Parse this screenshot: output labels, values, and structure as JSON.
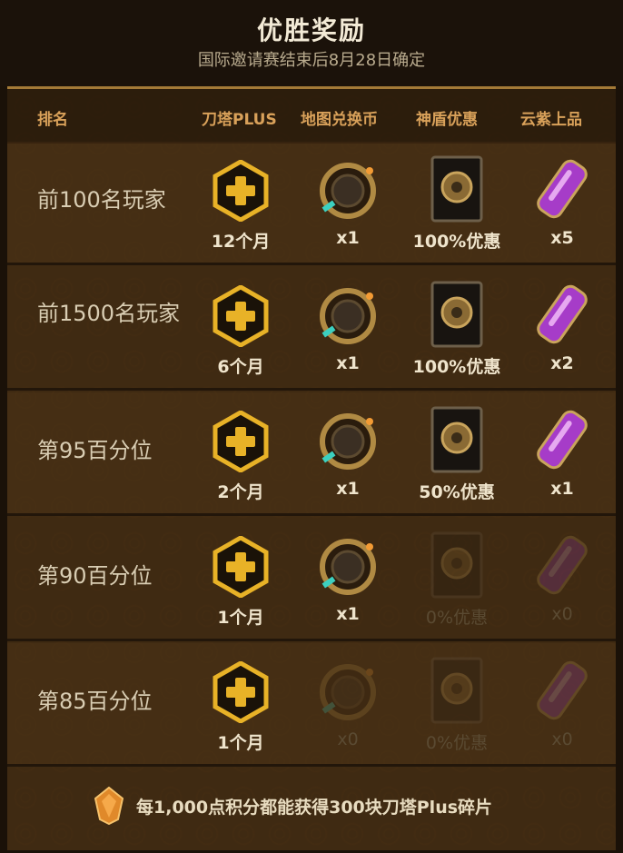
{
  "header": {
    "title": "优胜奖励",
    "subtitle": "国际邀请赛结束后8月28日确定"
  },
  "columns": {
    "rank": "排名",
    "plus": "刀塔PLUS",
    "map_coin": "地图兑换币",
    "shield": "神盾优惠",
    "cloud": "云紫上品"
  },
  "rows": [
    {
      "rank": "前100名玩家",
      "plus": "12个月",
      "map_coin": "x1",
      "shield": "100%优惠",
      "cloud": "x5"
    },
    {
      "rank": "前1500名玩家",
      "plus": "6个月",
      "map_coin": "x1",
      "shield": "100%优惠",
      "cloud": "x2"
    },
    {
      "rank": "第95百分位",
      "plus": "2个月",
      "map_coin": "x1",
      "shield": "50%优惠",
      "cloud": "x1"
    },
    {
      "rank": "第90百分位",
      "plus": "1个月",
      "map_coin": "x1",
      "shield": "0%优惠",
      "cloud": "x0"
    },
    {
      "rank": "第85百分位",
      "plus": "1个月",
      "map_coin": "x0",
      "shield": "0%优惠",
      "cloud": "x0"
    }
  ],
  "footer": {
    "text": "每1,000点积分都能获得300块刀塔Plus碎片",
    "icon": "plus-shard-icon"
  },
  "colors": {
    "accent_gold": "#d9a15a",
    "plus_gold": "#e8b227",
    "cloud_purple": "#a63cc8"
  }
}
